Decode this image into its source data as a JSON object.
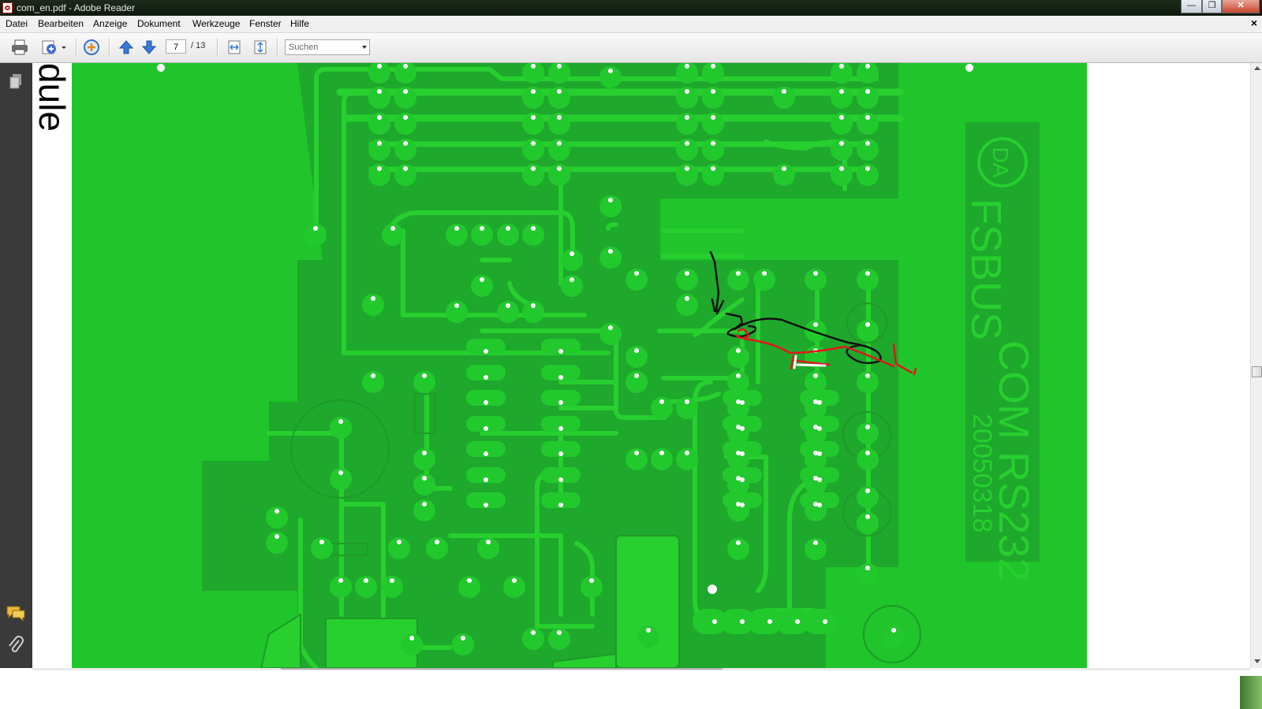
{
  "window": {
    "title": "com_en.pdf - Adobe Reader",
    "minimize_label": "—",
    "maximize_label": "❐",
    "close_label": "✕"
  },
  "menu": {
    "items": [
      "Datei",
      "Bearbeiten",
      "Anzeige",
      "Dokument",
      "Werkzeuge",
      "Fenster",
      "Hilfe"
    ],
    "close_doc_label": "×"
  },
  "toolbar": {
    "current_page": "7",
    "page_total": "/ 13",
    "search_placeholder": "Suchen"
  },
  "page": {
    "side_text": "dule",
    "pcb_labels": {
      "fsbus": "FSBUS",
      "com_rs232": "COM RS232",
      "date": "20050318"
    }
  },
  "colors": {
    "board": "#1fc52a",
    "copper": "#1ea82c",
    "trace": "#27cf2f",
    "annotation_red": "#e0161c",
    "annotation_black": "#111111"
  }
}
